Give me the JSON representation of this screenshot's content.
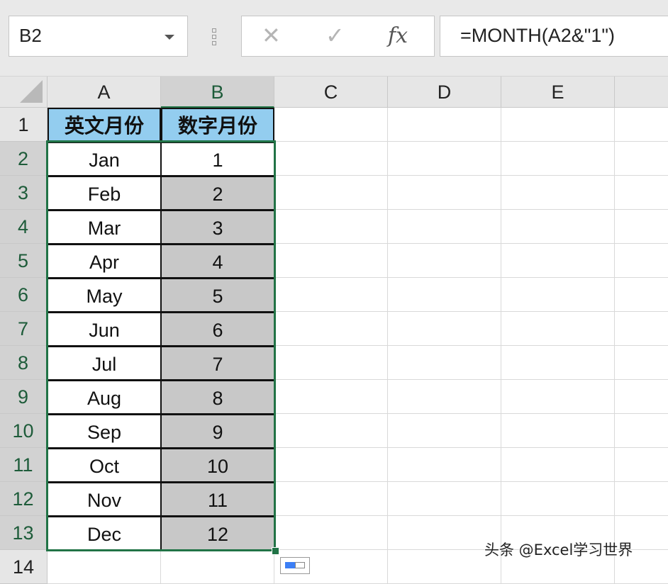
{
  "formula_bar": {
    "name_box": "B2",
    "cancel_icon": "✕",
    "enter_icon": "✓",
    "fx_label": "fx",
    "formula": "=MONTH(A2&\"1\")"
  },
  "columns": [
    "A",
    "B",
    "C",
    "D",
    "E"
  ],
  "selected_column": "B",
  "rows": [
    "1",
    "2",
    "3",
    "4",
    "5",
    "6",
    "7",
    "8",
    "9",
    "10",
    "11",
    "12",
    "13",
    "14"
  ],
  "headers": {
    "a": "英文月份",
    "b": "数字月份"
  },
  "table": [
    {
      "month": "Jan",
      "num": "1"
    },
    {
      "month": "Feb",
      "num": "2"
    },
    {
      "month": "Mar",
      "num": "3"
    },
    {
      "month": "Apr",
      "num": "4"
    },
    {
      "month": "May",
      "num": "5"
    },
    {
      "month": "Jun",
      "num": "6"
    },
    {
      "month": "Jul",
      "num": "7"
    },
    {
      "month": "Aug",
      "num": "8"
    },
    {
      "month": "Sep",
      "num": "9"
    },
    {
      "month": "Oct",
      "num": "10"
    },
    {
      "month": "Nov",
      "num": "11"
    },
    {
      "month": "Dec",
      "num": "12"
    }
  ],
  "colors": {
    "header_fill": "#93cdef",
    "selection": "#217346",
    "selected_fill": "#c8c8c8"
  },
  "watermark": "头条 @Excel学习世界"
}
